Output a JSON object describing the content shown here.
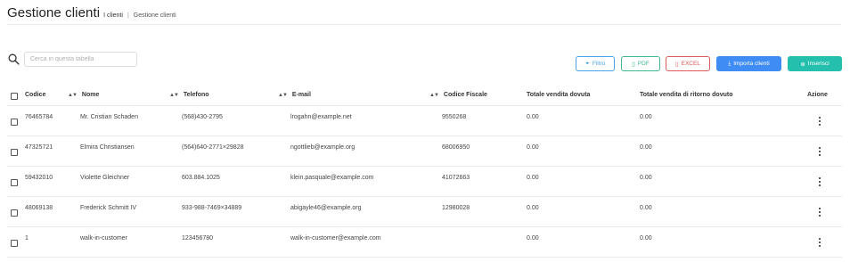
{
  "header": {
    "title": "Gestione clienti",
    "breadcrumb_active": "I clienti",
    "breadcrumb_separator": "|",
    "breadcrumb_link": "Gestione clienti"
  },
  "search": {
    "placeholder": "Cerca in questa tabella",
    "value": ""
  },
  "toolbar": {
    "filter_label": "Filtro",
    "pdf_label": "PDF",
    "excel_label": "EXCEL",
    "import_label": "Importa clienti",
    "insert_label": "Inserisci",
    "colors": {
      "filter": "#4aa3e8",
      "pdf": "#3fb98a",
      "excel": "#e05a5a",
      "import": "#3f8cf4",
      "insert": "#25bfae"
    },
    "icons": {
      "filter": "funnel-icon",
      "pdf": "file-icon",
      "excel": "file-icon",
      "import": "download-icon",
      "insert": "plus-circle-icon"
    }
  },
  "table": {
    "columns": {
      "code": "Codice",
      "name": "Nome",
      "phone": "Telefono",
      "email": "E-mail",
      "tax_code": "Codice Fiscale",
      "total_due": "Totale vendita dovuta",
      "total_return_due": "Totale vendita di ritorno dovuto",
      "actions": "Azione"
    },
    "rows": [
      {
        "code": "76465784",
        "name": "Mr. Cristian Schaden",
        "phone": "(568)430-2795",
        "email": "lrogahn@example.net",
        "tax_code": "9550268",
        "total_due": "0.00",
        "total_return_due": "0.00"
      },
      {
        "code": "47325721",
        "name": "Elmira Christiansen",
        "phone": "(564)640-2771×29828",
        "email": "ngottlieb@example.org",
        "tax_code": "68006950",
        "total_due": "0.00",
        "total_return_due": "0.00"
      },
      {
        "code": "59432010",
        "name": "Violette Gleichner",
        "phone": "603.884.1025",
        "email": "klein.pasquale@example.com",
        "tax_code": "41072663",
        "total_due": "0.00",
        "total_return_due": "0.00"
      },
      {
        "code": "48069138",
        "name": "Frederick Schmitt IV",
        "phone": "933-988-7469×34889",
        "email": "abigayle46@example.org",
        "tax_code": "12980028",
        "total_due": "0.00",
        "total_return_due": "0.00"
      },
      {
        "code": "1",
        "name": "walk-in-customer",
        "phone": "123456780",
        "email": "walk-in-customer@example.com",
        "tax_code": "",
        "total_due": "0.00",
        "total_return_due": "0.00"
      }
    ]
  }
}
